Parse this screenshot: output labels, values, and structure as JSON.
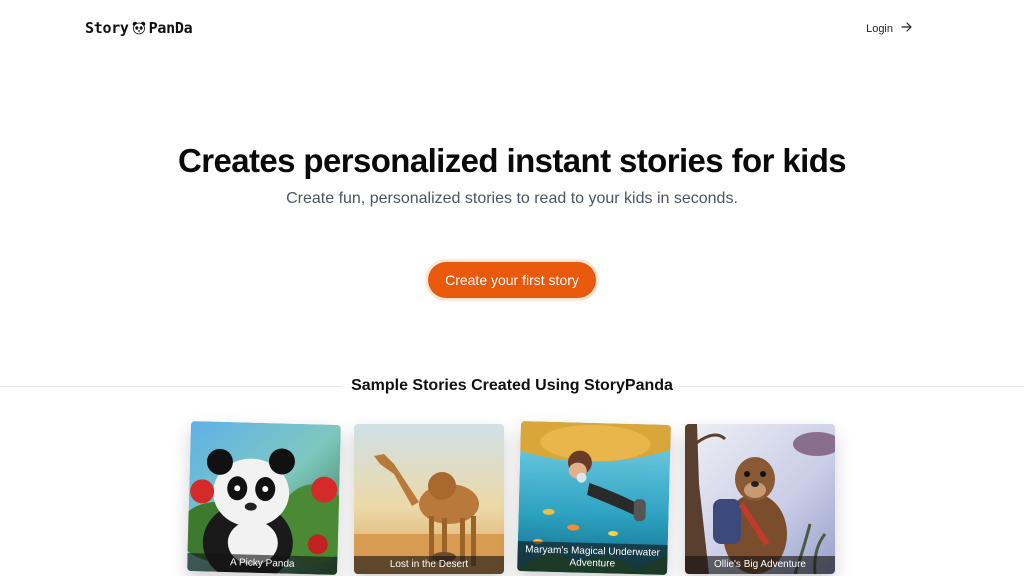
{
  "header": {
    "logo_left": "Story",
    "logo_right": "PanDa",
    "login_label": "Login"
  },
  "hero": {
    "title": "Creates personalized instant stories for kids",
    "subtitle": "Create fun, personalized stories to read to your kids in seconds.",
    "cta_label": "Create your first story"
  },
  "samples": {
    "section_title": "Sample Stories Created Using StoryPanda",
    "cards": [
      {
        "caption": "A Picky Panda"
      },
      {
        "caption": "Lost in the Desert"
      },
      {
        "caption": "Maryam's Magical Underwater Adventure"
      },
      {
        "caption": "Ollie's Big Adventure"
      }
    ]
  },
  "colors": {
    "accent": "#e8590c",
    "text": "#0a0a0a",
    "muted": "#4b5563"
  }
}
